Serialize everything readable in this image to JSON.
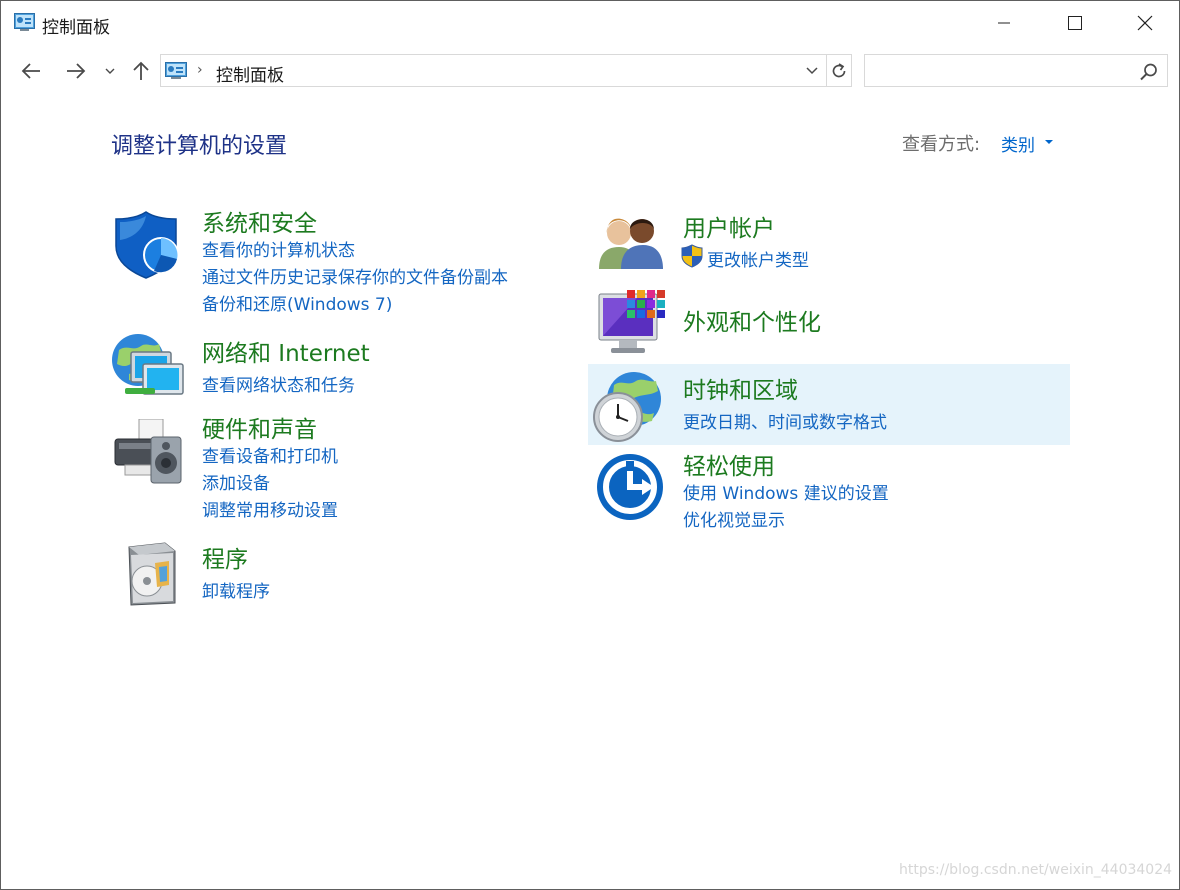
{
  "window": {
    "title": "控制面板"
  },
  "address_bar": {
    "path": "控制面板",
    "separator": "›"
  },
  "search": {
    "placeholder": ""
  },
  "header": {
    "page_title": "调整计算机的设置",
    "view_label": "查看方式:",
    "view_value": "类别"
  },
  "categories": {
    "system_security": {
      "title": "系统和安全",
      "links": [
        "查看你的计算机状态",
        "通过文件历史记录保存你的文件备份副本",
        "备份和还原(Windows 7)"
      ]
    },
    "network": {
      "title": "网络和 Internet",
      "links": [
        "查看网络状态和任务"
      ]
    },
    "hardware": {
      "title": "硬件和声音",
      "links": [
        "查看设备和打印机",
        "添加设备",
        "调整常用移动设置"
      ]
    },
    "programs": {
      "title": "程序",
      "links": [
        "卸载程序"
      ]
    },
    "user_accounts": {
      "title": "用户帐户",
      "links": [
        "更改帐户类型"
      ]
    },
    "appearance": {
      "title": "外观和个性化",
      "links": []
    },
    "clock_region": {
      "title": "时钟和区域",
      "links": [
        "更改日期、时间或数字格式"
      ]
    },
    "ease_of_access": {
      "title": "轻松使用",
      "links": [
        "使用 Windows 建议的设置",
        "优化视觉显示"
      ]
    }
  },
  "watermark": "https://blog.csdn.net/weixin_44034024",
  "colors": {
    "title_blue": "#1e3287",
    "category_green": "#1c7a1f",
    "link_blue": "#1466c2",
    "hover_bg": "#e5f3fb"
  }
}
